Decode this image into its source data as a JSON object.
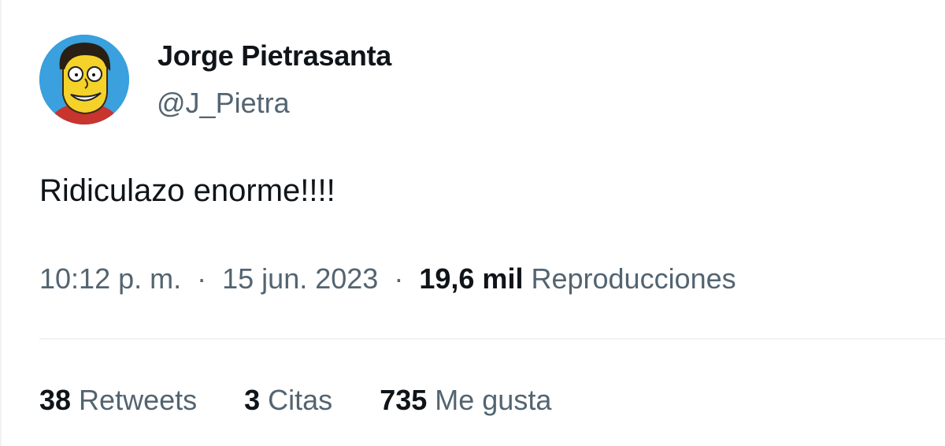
{
  "author": {
    "name": "Jorge Pietrasanta",
    "handle": "@J_Pietra",
    "avatar_icon": "cartoon-portrait-avatar"
  },
  "tweet": {
    "text": "Ridiculazo enorme!!!!"
  },
  "meta": {
    "time": "10:12 p. m.",
    "separator": "·",
    "date": "15 jun. 2023",
    "views_count": "19,6 mil",
    "views_label": "Reproducciones"
  },
  "stats": {
    "retweets_count": "38",
    "retweets_label": "Retweets",
    "quotes_count": "3",
    "quotes_label": "Citas",
    "likes_count": "735",
    "likes_label": "Me gusta"
  },
  "colors": {
    "text_primary": "#0f1419",
    "text_secondary": "#536471",
    "divider": "#eff3f4",
    "avatar_background": "#3aa0de"
  }
}
